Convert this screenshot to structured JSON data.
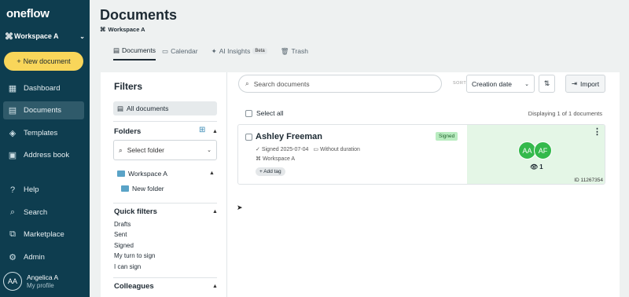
{
  "sidebar": {
    "logo": "oneflow",
    "workspace": "Workspace A",
    "new_document": "New document",
    "items": [
      {
        "label": "Dashboard",
        "icon": "dashboard-icon"
      },
      {
        "label": "Documents",
        "icon": "documents-icon"
      },
      {
        "label": "Templates",
        "icon": "templates-icon"
      },
      {
        "label": "Address book",
        "icon": "address-book-icon"
      },
      {
        "label": "Help",
        "icon": "help-icon"
      },
      {
        "label": "Search",
        "icon": "search-icon"
      },
      {
        "label": "Marketplace",
        "icon": "marketplace-icon"
      },
      {
        "label": "Admin",
        "icon": "admin-icon"
      }
    ],
    "profile": {
      "initials": "AA",
      "name": "Angelica A",
      "sub": "My profile"
    }
  },
  "header": {
    "title": "Documents",
    "breadcrumb": "Workspace A",
    "tabs": [
      {
        "label": "Documents"
      },
      {
        "label": "Calendar"
      },
      {
        "label": "AI Insights",
        "badge": "Beta"
      },
      {
        "label": "Trash"
      }
    ]
  },
  "filters": {
    "title": "Filters",
    "all_documents": "All documents",
    "folders_title": "Folders",
    "select_folder": "Select folder",
    "folder_root": "Workspace A",
    "folder_child": "New folder",
    "quick_filters_title": "Quick filters",
    "quick_filters": [
      "Drafts",
      "Sent",
      "Signed",
      "My turn to sign",
      "I can sign"
    ],
    "colleagues_title": "Colleagues"
  },
  "toolbar": {
    "search_placeholder": "Search documents",
    "sort_label": "SORT",
    "sort_value": "Creation date",
    "import_label": "Import"
  },
  "list": {
    "select_all": "Select all",
    "displaying": "Displaying 1 of 1 documents"
  },
  "document": {
    "name": "Ashley Freeman",
    "status": "Signed",
    "signed_date": "Signed 2025-07-04",
    "duration": "Without duration",
    "workspace": "Workspace A",
    "add_tag": "+ Add tag",
    "participants": [
      "AA",
      "AF"
    ],
    "views": "1",
    "id": "ID 11267354"
  },
  "colors": {
    "sidebar": "#0e3d4f",
    "accent_yellow": "#f9d65a",
    "signed_green": "#34b94c"
  }
}
